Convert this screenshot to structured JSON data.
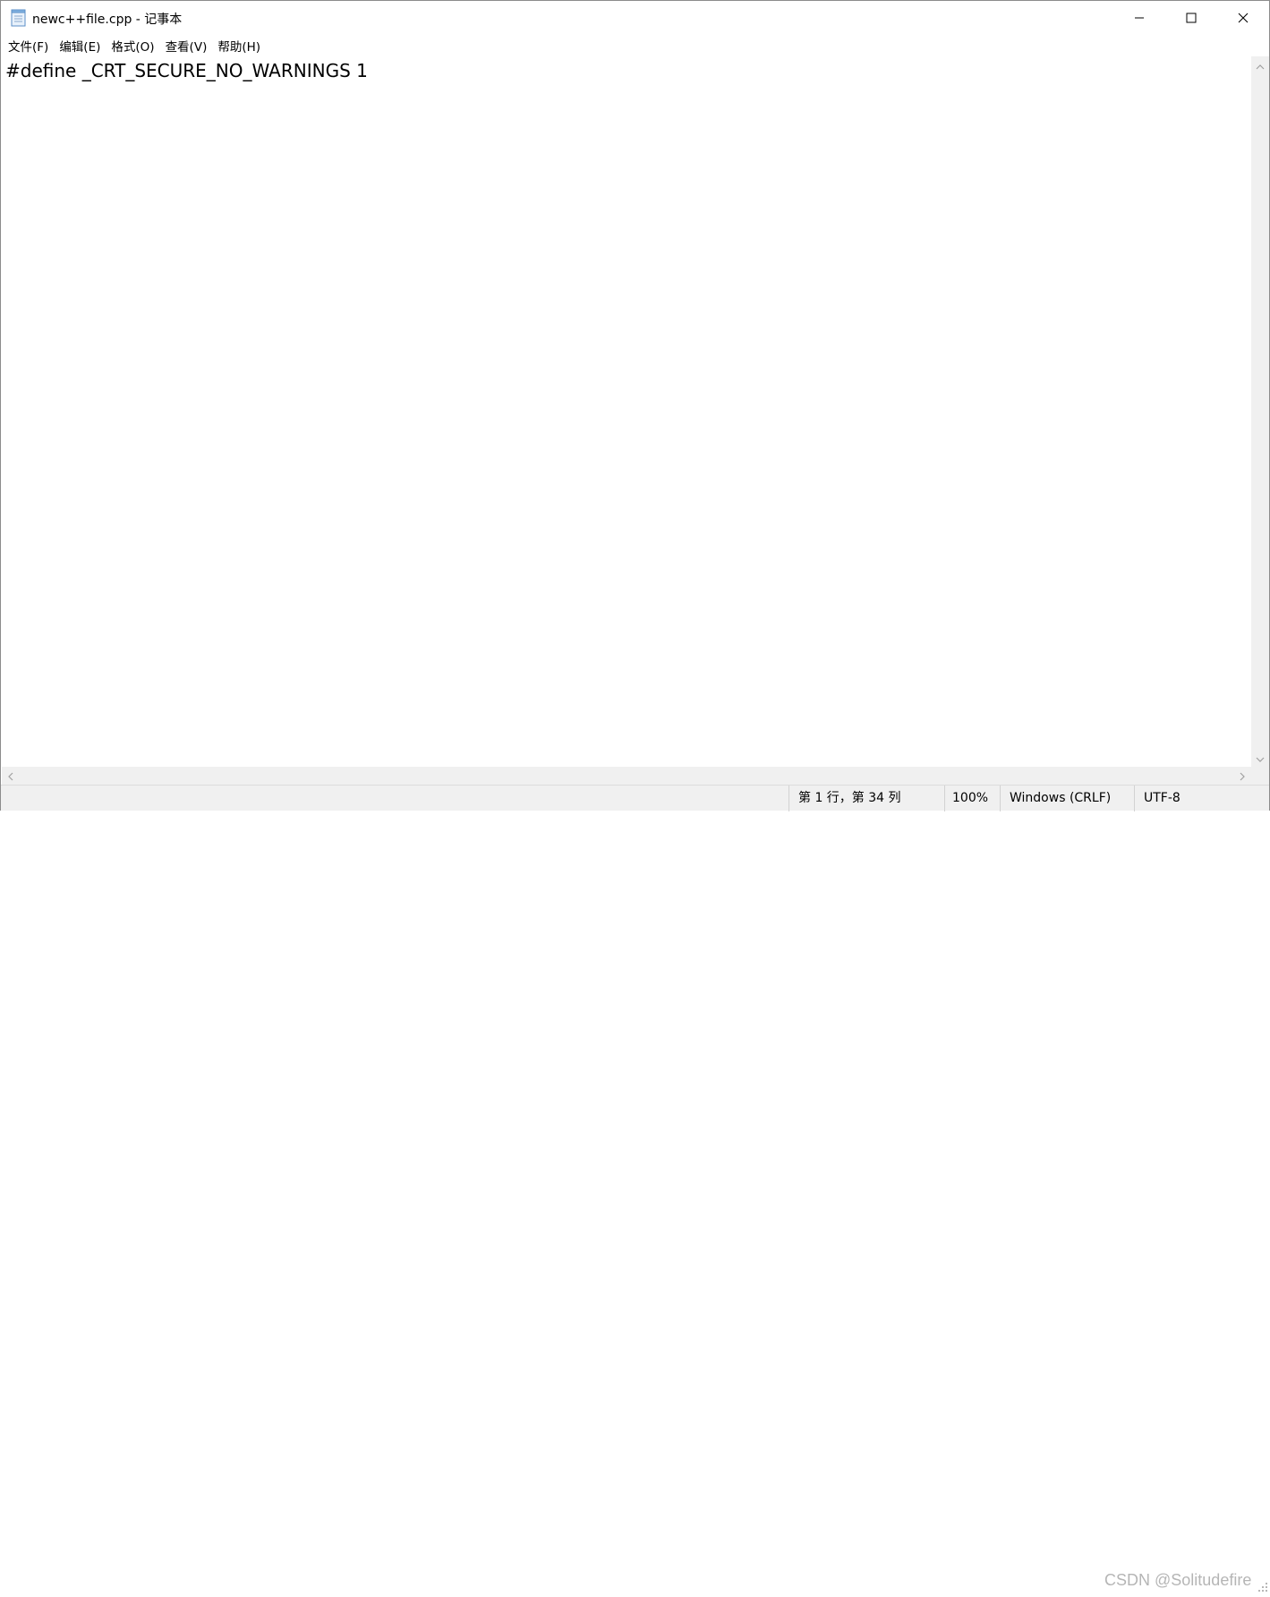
{
  "window": {
    "title": "newc++file.cpp - 记事本",
    "icon": "notepad-icon",
    "controls": {
      "minimize": "minimize-icon",
      "maximize": "maximize-icon",
      "close": "close-icon"
    }
  },
  "menu": {
    "items": [
      {
        "label": "文件(F)"
      },
      {
        "label": "编辑(E)"
      },
      {
        "label": "格式(O)"
      },
      {
        "label": "查看(V)"
      },
      {
        "label": "帮助(H)"
      }
    ]
  },
  "editor": {
    "content": "#define _CRT_SECURE_NO_WARNINGS 1"
  },
  "status": {
    "position": "第 1 行，第 34 列",
    "zoom": "100%",
    "line_ending": "Windows (CRLF)",
    "encoding": "UTF-8"
  },
  "watermark": "CSDN @Solitudefire",
  "colors": {
    "background": "#ffffff",
    "chrome": "#f0f0f0",
    "text": "#000000"
  }
}
